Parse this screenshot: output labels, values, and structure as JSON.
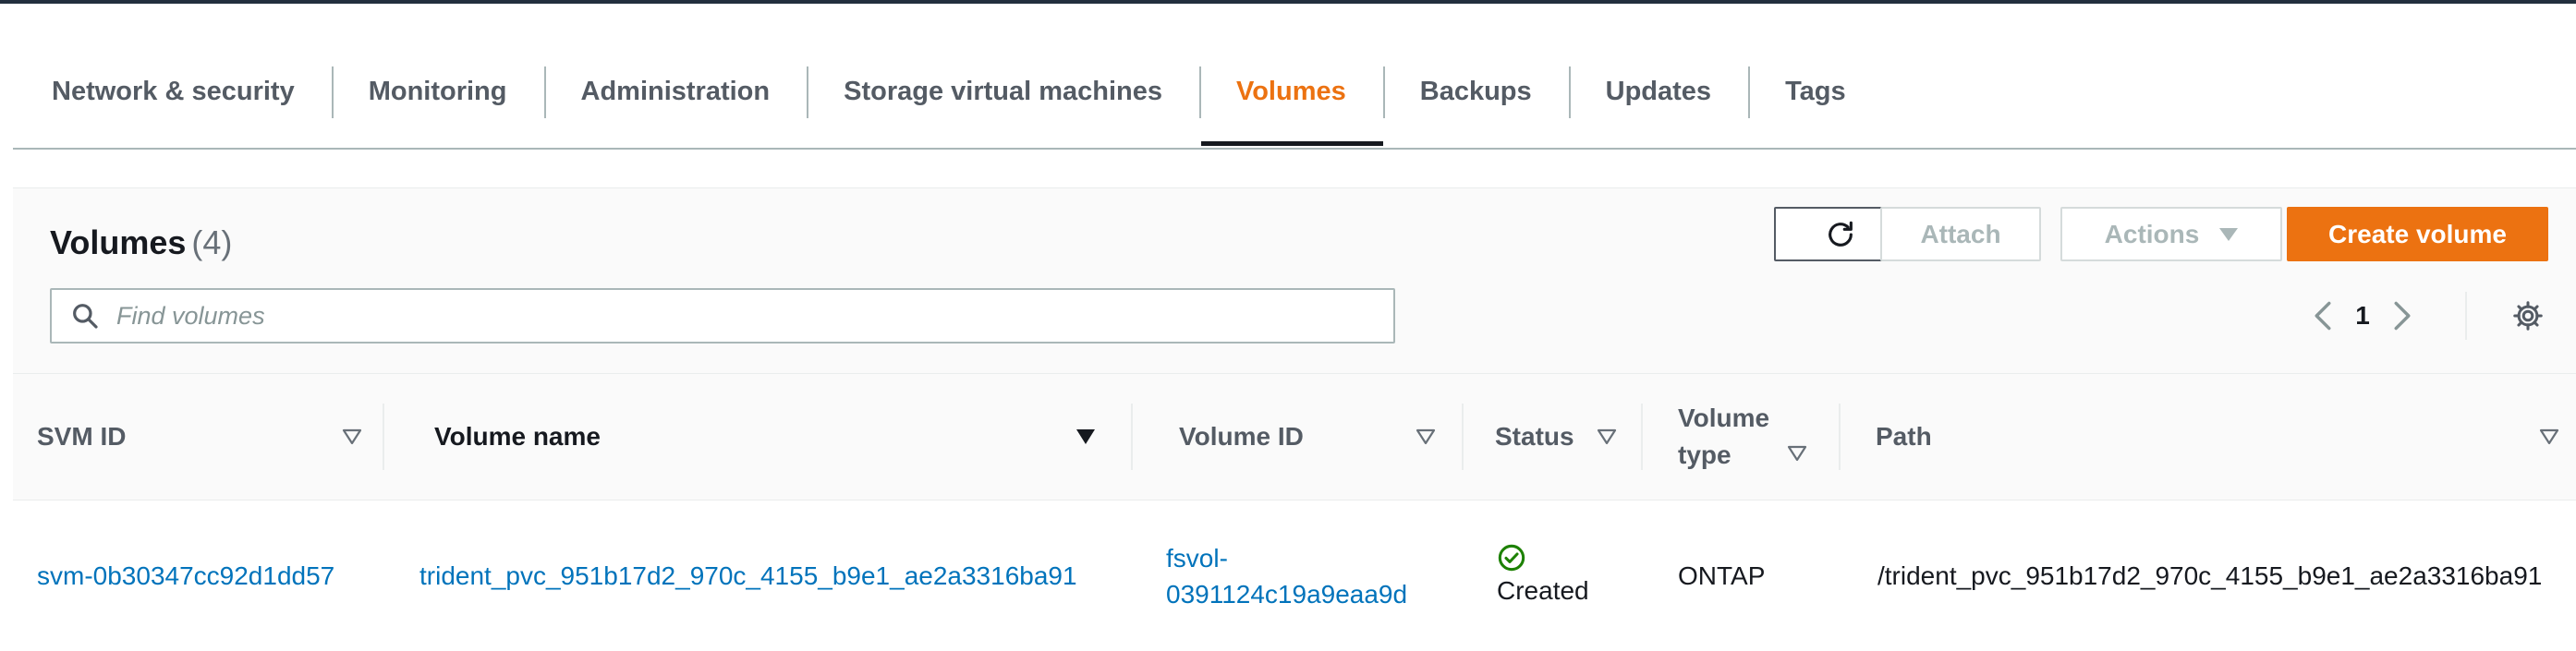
{
  "tabs": [
    {
      "label": "Network & security"
    },
    {
      "label": "Monitoring"
    },
    {
      "label": "Administration"
    },
    {
      "label": "Storage virtual machines"
    },
    {
      "label": "Volumes",
      "active": true
    },
    {
      "label": "Backups"
    },
    {
      "label": "Updates"
    },
    {
      "label": "Tags"
    }
  ],
  "panel": {
    "title": "Volumes",
    "count": "(4)",
    "buttons": {
      "attach": "Attach",
      "actions": "Actions",
      "create": "Create volume"
    },
    "search": {
      "placeholder": "Find volumes",
      "value": ""
    },
    "pagination": {
      "current_page": "1"
    }
  },
  "table": {
    "columns": {
      "svm_id": "SVM ID",
      "volume_name": "Volume name",
      "volume_id": "Volume ID",
      "status": "Status",
      "volume_type_line1": "Volume",
      "volume_type_line2": "type",
      "path": "Path"
    },
    "rows": [
      {
        "svm_id": "svm-0b30347cc92d1dd57",
        "volume_name": "trident_pvc_951b17d2_970c_4155_b9e1_ae2a3316ba91",
        "volume_id_line1": "fsvol-",
        "volume_id_line2": "0391124c19a9eaa9d",
        "status": "Created",
        "volume_type": "ONTAP",
        "path": "/trident_pvc_951b17d2_970c_4155_b9e1_ae2a3316ba91"
      }
    ]
  },
  "colors": {
    "accent": "#ec7211",
    "link": "#0073bb",
    "success": "#1d8102",
    "text": "#16191f",
    "muted": "#545b64"
  },
  "icons": {
    "refresh": "refresh-icon",
    "search": "search-icon",
    "prev": "chevron-left-icon",
    "next": "chevron-right-icon",
    "settings": "gear-icon",
    "status": "check-circle-icon"
  }
}
